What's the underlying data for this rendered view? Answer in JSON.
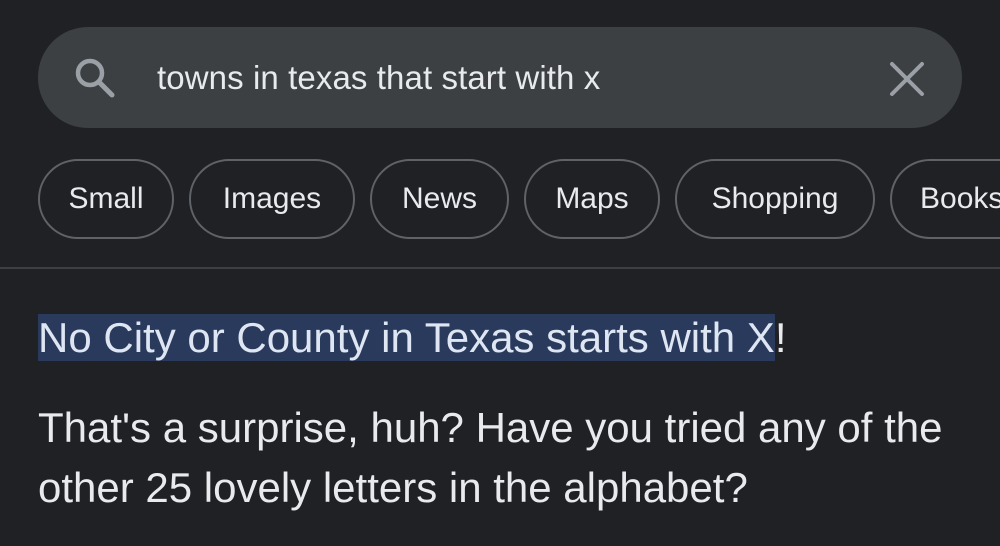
{
  "search": {
    "query": "towns in texas that start with x",
    "icon": "search-icon",
    "clear_icon": "close-icon"
  },
  "chips": [
    {
      "label": "Small"
    },
    {
      "label": "Images"
    },
    {
      "label": "News"
    },
    {
      "label": "Maps"
    },
    {
      "label": "Shopping"
    },
    {
      "label": "Books"
    }
  ],
  "answer": {
    "title_highlighted": "No City or County in Texas starts with X",
    "title_rest": "!",
    "body": "That's a surprise, huh? Have you tried any of the other 25 lovely letters in the alphabet?"
  },
  "colors": {
    "background": "#202124",
    "search_bar": "#3c4043",
    "text": "#e8eaed",
    "highlight": "#2a3a5c",
    "chip_border": "#5f6368"
  }
}
